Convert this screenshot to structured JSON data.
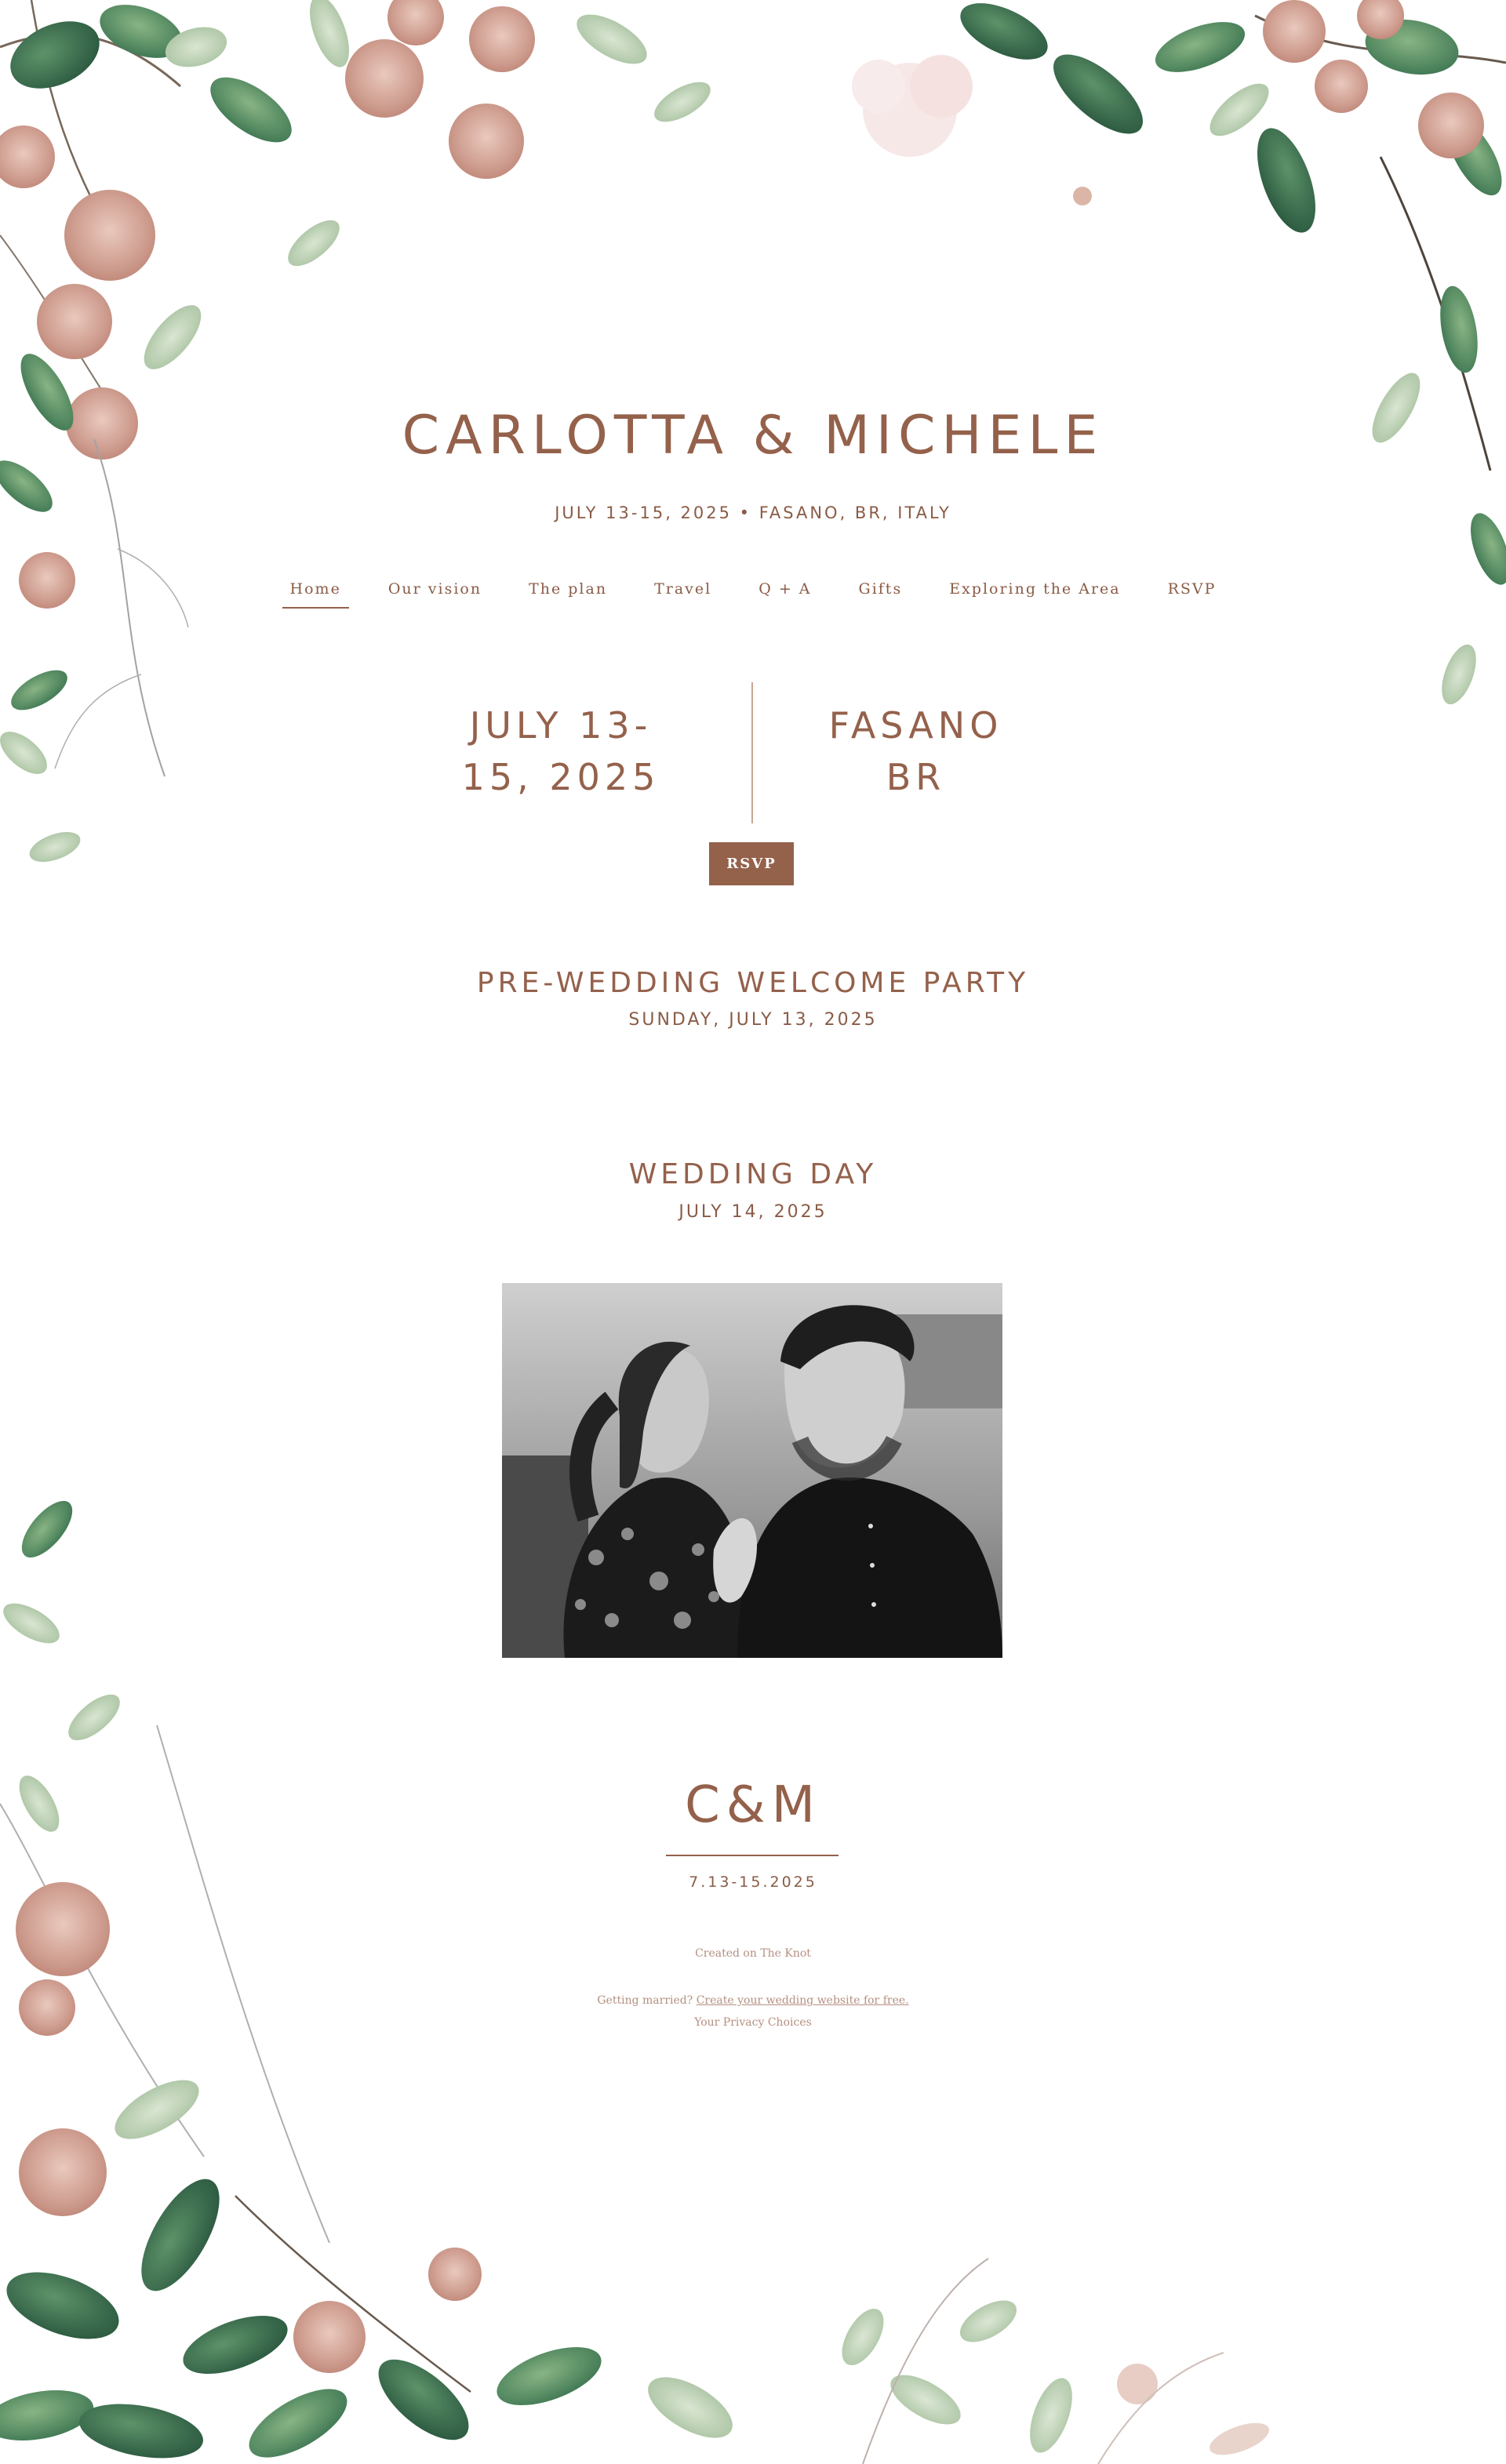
{
  "header": {
    "couple_names": "CARLOTTA & MICHELE",
    "tagline": "JULY 13-15, 2025 • FASANO, BR, ITALY"
  },
  "nav": {
    "items": [
      {
        "label": "Home",
        "active": true
      },
      {
        "label": "Our vision",
        "active": false
      },
      {
        "label": "The plan",
        "active": false
      },
      {
        "label": "Travel",
        "active": false
      },
      {
        "label": "Q + A",
        "active": false
      },
      {
        "label": "Gifts",
        "active": false
      },
      {
        "label": "Exploring the Area",
        "active": false
      },
      {
        "label": "RSVP",
        "active": false
      }
    ]
  },
  "hero": {
    "date_line1": "JULY 13-",
    "date_line2": "15, 2025",
    "place_line1": "FASANO",
    "place_line2": "BR",
    "rsvp_label": "RSVP"
  },
  "events": [
    {
      "title": "PRE-WEDDING WELCOME PARTY",
      "date": "SUNDAY, JULY 13, 2025"
    },
    {
      "title": "WEDDING DAY",
      "date": "JULY 14, 2025"
    }
  ],
  "closing": {
    "monogram": "C&M",
    "date": "7.13-15.2025"
  },
  "footer": {
    "created_on": "Created on The Knot",
    "getting_married": "Getting married?",
    "create_link": "Create your wedding website for free.",
    "privacy": "Your Privacy Choices"
  },
  "colors": {
    "accent": "#94614b",
    "button_text": "#ffffff",
    "footer_text": "#b58f81"
  }
}
